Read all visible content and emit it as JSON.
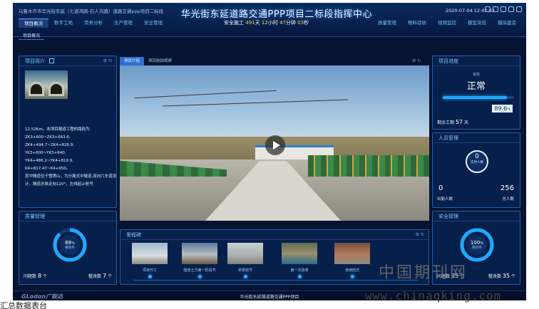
{
  "header": {
    "location": "乌鲁木齐市华光街东延（七道湾路-石人沟路）道路交通ppp项目二标段",
    "title": "华光街东延道路交通PPP项目二标段指挥中心",
    "datetime": "2020-07-04 12:47:02",
    "nav_left": [
      "项目概况",
      "数字工地",
      "劳务分析",
      "生产管理",
      "安全管理"
    ],
    "nav_right": [
      "质量管理",
      "物料验收",
      "视频监控",
      "模型浏览",
      "模拟建造"
    ],
    "safe_prefix": "安全施工",
    "safe_days": "491",
    "safe_days_unit": "天",
    "safe_hours": "12",
    "safe_hours_unit": "小时",
    "safe_minutes": "47",
    "safe_minutes_unit": "分钟",
    "safe_seconds": "03",
    "safe_seconds_unit": "秒"
  },
  "breadcrumb": "项目概况",
  "intro": {
    "title": "项目简介",
    "text": "12.52Km。本项目隧道工程的路段为ZK3+600~ZK3+663.6,\nZK4+494.7~ZK4+828.9,\nYK3+600~YK3+640,\nYK4+486.2~YK4+819.9,\nK4+817.47~K4+950。\n其中隧道位于雪莲山，为分离式中隧道,双向六车道设计，隧道总体走向120°，左线起止桩号"
  },
  "video": {
    "tabs": [
      "项目介绍",
      "项目航拍视频"
    ]
  },
  "progress": {
    "title": "项目进度",
    "status_label": "状态",
    "status_value": "正常",
    "percent_text": "89.6",
    "percent_unit": "%",
    "percent": 89.6,
    "remaining_label": "剩余工期",
    "remaining_value": "57",
    "remaining_unit": "天"
  },
  "personnel": {
    "title": "人员管理",
    "realtime_value": "0",
    "realtime_label": "实时人数",
    "attendance_value": "0",
    "attendance_label": "出勤人数",
    "total_value": "256",
    "total_label": "总人数"
  },
  "quality": {
    "title": "质量管理",
    "rate_text": "88",
    "rate_unit": "%",
    "rate": 88,
    "rate_label": "整改率",
    "issues_label": "问题数",
    "issues_value": "8",
    "issues_unit": "个",
    "fixed_label": "整改数",
    "fixed_value": "7",
    "fixed_unit": "个"
  },
  "safety": {
    "title": "安全管理",
    "rate_text": "100",
    "rate_unit": "%",
    "rate": 100,
    "rate_label": "整改率",
    "issues_label": "问题数",
    "issues_value": "35",
    "issues_unit": "个",
    "fixed_label": "整改数",
    "fixed_value": "35",
    "fixed_unit": "个"
  },
  "milestones": {
    "title": "里程碑",
    "items": [
      {
        "label": "项目开工"
      },
      {
        "label": "隧道土方第一阶段节"
      },
      {
        "label": "桥梁结节"
      },
      {
        "label": "第一次验收"
      },
      {
        "label": "连续结式"
      }
    ]
  },
  "footer": {
    "brand": "GLodon广联达",
    "center": "华光街东延隧道路交通PPP项目"
  },
  "watermark": {
    "cn": "中国期刊网",
    "url": "www.chinaqking.com"
  },
  "caption": "汇总数据表台"
}
